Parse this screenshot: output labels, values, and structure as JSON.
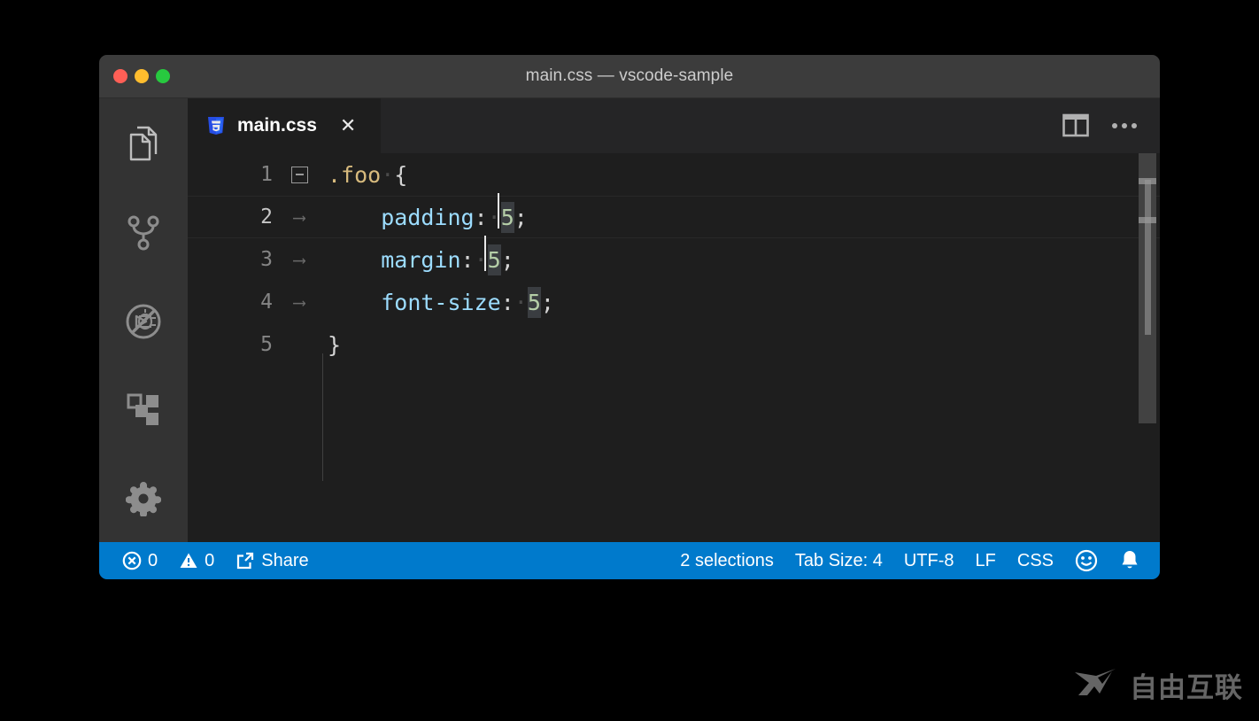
{
  "window": {
    "title": "main.css — vscode-sample",
    "traffic_lights": [
      {
        "name": "close",
        "color": "#ff5f56"
      },
      {
        "name": "minimize",
        "color": "#ffbd2e"
      },
      {
        "name": "zoom",
        "color": "#27c93f"
      }
    ]
  },
  "activity_bar": {
    "items": [
      {
        "id": "explorer",
        "label": "Explorer",
        "icon": "files-icon",
        "active": true
      },
      {
        "id": "source-control",
        "label": "Source Control",
        "icon": "source-control-icon",
        "active": false
      },
      {
        "id": "run-debug",
        "label": "Run and Debug",
        "icon": "run-debug-disabled-icon",
        "active": false
      },
      {
        "id": "extensions",
        "label": "Extensions",
        "icon": "extensions-icon",
        "active": false
      },
      {
        "id": "settings",
        "label": "Manage",
        "icon": "gear-icon",
        "active": false
      }
    ]
  },
  "tabs": [
    {
      "label": "main.css",
      "icon": "css-file-icon",
      "active": true,
      "close_glyph": "✕"
    }
  ],
  "editor_actions": [
    {
      "id": "split-editor",
      "label": "Split Editor",
      "icon": "split-editor-icon"
    },
    {
      "id": "more-actions",
      "label": "More Actions...",
      "icon": "ellipsis-icon"
    }
  ],
  "editor": {
    "language": "CSS",
    "lines": [
      {
        "number": "1",
        "gutter": "fold",
        "tokens": [
          {
            "text": ".foo",
            "kind": "selector"
          },
          {
            "text": "·",
            "kind": "whitespace"
          },
          {
            "text": "{",
            "kind": "brace"
          }
        ]
      },
      {
        "number": "2",
        "gutter": "tab",
        "current": true,
        "tokens": [
          {
            "text": "    ",
            "kind": "indent"
          },
          {
            "text": "padding",
            "kind": "property"
          },
          {
            "text": ":",
            "kind": "punct"
          },
          {
            "text": "·",
            "kind": "whitespace"
          },
          {
            "text": "5",
            "kind": "number",
            "selected": true,
            "cursor": "left"
          },
          {
            "text": ";",
            "kind": "punct"
          }
        ]
      },
      {
        "number": "3",
        "gutter": "tab",
        "tokens": [
          {
            "text": "    ",
            "kind": "indent"
          },
          {
            "text": "margin",
            "kind": "property"
          },
          {
            "text": ":",
            "kind": "punct"
          },
          {
            "text": "·",
            "kind": "whitespace"
          },
          {
            "text": "5",
            "kind": "number",
            "selected": true,
            "cursor": "left"
          },
          {
            "text": ";",
            "kind": "punct"
          }
        ]
      },
      {
        "number": "4",
        "gutter": "tab",
        "tokens": [
          {
            "text": "    ",
            "kind": "indent"
          },
          {
            "text": "font-size",
            "kind": "property"
          },
          {
            "text": ":",
            "kind": "punct"
          },
          {
            "text": "·",
            "kind": "whitespace"
          },
          {
            "text": "5",
            "kind": "number",
            "selected": true
          },
          {
            "text": ";",
            "kind": "punct"
          }
        ]
      },
      {
        "number": "5",
        "gutter": "none",
        "tokens": [
          {
            "text": "}",
            "kind": "brace"
          }
        ]
      }
    ],
    "colors": {
      "background": "#1e1e1e",
      "selector": "#d7ba7d",
      "property": "#9cdcfe",
      "number": "#b5cea8",
      "punctuation": "#d4d4d4",
      "line_number": "#858585",
      "selection": "#3a3d41",
      "cursor": "#e8e8e8"
    }
  },
  "status_bar": {
    "background": "#007acc",
    "left": [
      {
        "id": "errors",
        "icon": "error-circle-icon",
        "value": "0"
      },
      {
        "id": "warnings",
        "icon": "warning-triangle-icon",
        "value": "0"
      },
      {
        "id": "share",
        "icon": "share-icon",
        "value": "Share"
      }
    ],
    "right": [
      {
        "id": "selections",
        "value": "2 selections"
      },
      {
        "id": "tab-size",
        "value": "Tab Size: 4"
      },
      {
        "id": "encoding",
        "value": "UTF-8"
      },
      {
        "id": "eol",
        "value": "LF"
      },
      {
        "id": "language-mode",
        "value": "CSS"
      },
      {
        "id": "feedback",
        "icon": "smiley-icon",
        "value": ""
      },
      {
        "id": "notifications",
        "icon": "bell-icon",
        "value": ""
      }
    ]
  },
  "watermark": {
    "text": "自由互联",
    "logo": "x-logo-icon"
  }
}
